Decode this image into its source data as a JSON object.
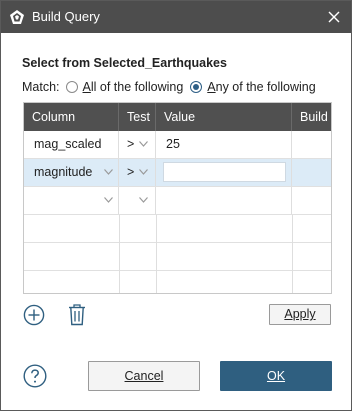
{
  "window": {
    "title": "Build Query",
    "icon": "app-logo-icon",
    "close_icon": "close-icon"
  },
  "query": {
    "section_title": "Select from Selected_Earthquakes",
    "match_label": "Match:",
    "options": [
      {
        "accel": "A",
        "rest": "ll of the following",
        "checked": false
      },
      {
        "accel": "A",
        "rest": "ny of the following",
        "checked": true
      }
    ]
  },
  "table": {
    "headers": [
      "Column",
      "Test",
      "Value",
      "Build"
    ],
    "rows": [
      {
        "column": "mag_scaled",
        "test": ">",
        "value": "25",
        "selected": false
      },
      {
        "column": "magnitude",
        "test": ">",
        "value": "",
        "selected": true
      },
      {
        "column": "",
        "test": "",
        "value": "",
        "selected": false
      }
    ]
  },
  "actions": {
    "add_icon": "add-circle-icon",
    "delete_icon": "trash-icon",
    "apply_label": "Apply",
    "help_icon": "help-icon",
    "cancel_label": "Cancel",
    "ok_label": "OK"
  },
  "colors": {
    "titlebar": "#4d4d4d",
    "header": "#505050",
    "accent": "#2f5f80",
    "selected_row": "#dcebf7"
  }
}
